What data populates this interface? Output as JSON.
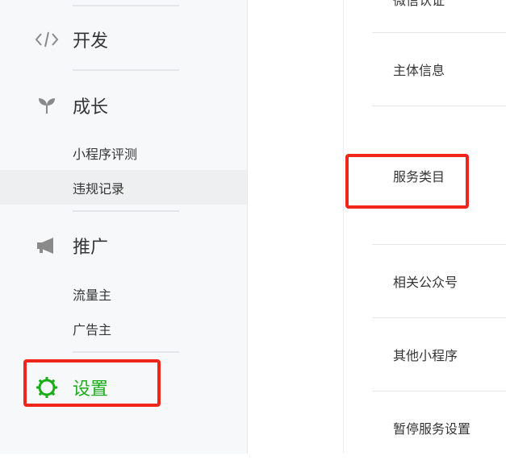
{
  "sidebar": {
    "develop": {
      "label": "开发",
      "icon": "code-icon"
    },
    "growth": {
      "label": "成长",
      "icon": "sprout-icon",
      "items": [
        {
          "label": "小程序评测"
        },
        {
          "label": "违规记录"
        }
      ]
    },
    "promote": {
      "label": "推广",
      "icon": "megaphone-icon",
      "items": [
        {
          "label": "流量主"
        },
        {
          "label": "广告主"
        }
      ]
    },
    "settings": {
      "label": "设置",
      "icon": "gear-icon",
      "color": "#1aad19"
    }
  },
  "main": {
    "partial_top_label": "微信认证",
    "rows": [
      {
        "label": "主体信息"
      },
      {
        "label": "服务类目"
      },
      {
        "label": "相关公众号"
      },
      {
        "label": "其他小程序"
      },
      {
        "label": "暂停服务设置"
      }
    ]
  },
  "highlight_color": "#f0261c"
}
